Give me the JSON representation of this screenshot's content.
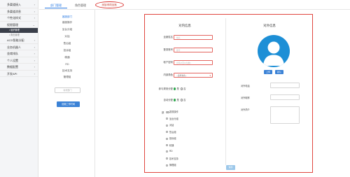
{
  "sidebar": {
    "items": [
      {
        "label": "多渠道接入",
        "expanded": false
      },
      {
        "label": "多渠道消息",
        "expanded": false
      },
      {
        "label": "个性化样式",
        "expanded": false
      },
      {
        "label": "权限管理",
        "expanded": true
      }
    ],
    "sub_items": [
      {
        "label": "• 组织管理",
        "active": true
      },
      {
        "label": "• 角色管理",
        "active": false
      }
    ],
    "more_items": [
      {
        "label": "ACD智能分配"
      },
      {
        "label": "业务机器人"
      },
      {
        "label": "坐席排队"
      },
      {
        "label": "个人设置"
      },
      {
        "label": "数据配置"
      },
      {
        "label": "开发API"
      }
    ]
  },
  "tabs": [
    {
      "label": "部门管理"
    },
    {
      "label": "角色管理"
    },
    {
      "label": "添加/修改坐席"
    }
  ],
  "tree": {
    "root": "客服部门",
    "children": [
      "客服操作",
      "坐台分组",
      "对话",
      "售后组",
      "投诉组",
      "精通",
      "RD",
      "技术支持",
      "管理组"
    ],
    "input_placeholder": "新增部门",
    "action_label": "设置工作时间"
  },
  "form": {
    "left_title": "对内信息",
    "right_title": "对外信息",
    "fields": [
      {
        "label": "坐席姓名",
        "placeholder": "姓名"
      },
      {
        "label": "登录账号",
        "placeholder": "账号"
      },
      {
        "label": "帐户密码",
        "placeholder": "密码(6至16位数)"
      }
    ],
    "role": {
      "label": "内部角色",
      "value": "--选择角色--"
    },
    "radios": [
      {
        "label": "参与规则分配",
        "options": [
          "是",
          "否"
        ],
        "selected": 0
      },
      {
        "label": "自动分配",
        "options": [
          "是",
          "否"
        ],
        "selected": 0
      }
    ],
    "permission_label": "部",
    "permissions": [
      "发现操作",
      "坐台分组",
      "对话",
      "售后组",
      "投诉组",
      "精通",
      "RD",
      "技术支持",
      "管理组"
    ],
    "avatar_upload_label": "上传",
    "avatar_default_label": "默认",
    "right_fields": [
      "对外电话",
      "对外昵称",
      "对外简介"
    ],
    "save_label": "保存"
  },
  "colors": {
    "accent": "#2a7ae2",
    "highlight_border": "#e0463f",
    "avatar_bg": "#1d8fd6",
    "radio_on": "#2fa84f"
  }
}
